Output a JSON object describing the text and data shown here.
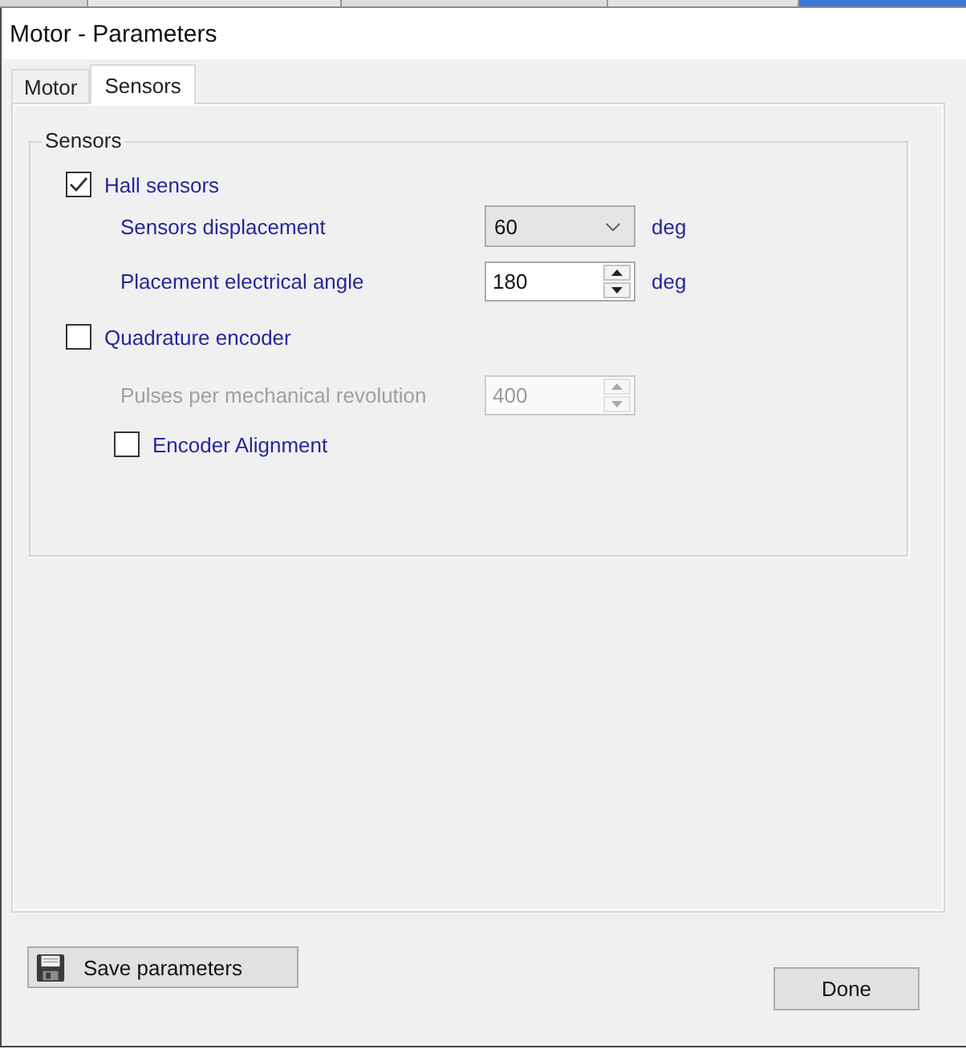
{
  "window": {
    "title": "Motor - Parameters"
  },
  "tabs": [
    {
      "label": "Motor",
      "selected": false
    },
    {
      "label": "Sensors",
      "selected": true
    }
  ],
  "group": {
    "title": "Sensors",
    "items": [
      {
        "kind": "checkbox",
        "label": "Hall sensors",
        "checked": true,
        "children": [
          {
            "kind": "dropdown",
            "label": "Sensors displacement",
            "value": "60",
            "unit": "deg",
            "disabled": false
          },
          {
            "kind": "spinner",
            "label": "Placement electrical angle",
            "value": "180",
            "unit": "deg",
            "disabled": false
          }
        ]
      },
      {
        "kind": "checkbox",
        "label": "Quadrature encoder",
        "checked": false,
        "children": [
          {
            "kind": "spinner",
            "label": "Pulses per mechanical revolution",
            "value": "400",
            "disabled": true
          },
          {
            "kind": "checkbox",
            "label": "Encoder Alignment",
            "checked": false,
            "disabled": false
          }
        ]
      }
    ]
  },
  "buttons": [
    {
      "kind": "save",
      "label": "Save parameters"
    },
    {
      "kind": "plain",
      "label": "Done"
    }
  ]
}
